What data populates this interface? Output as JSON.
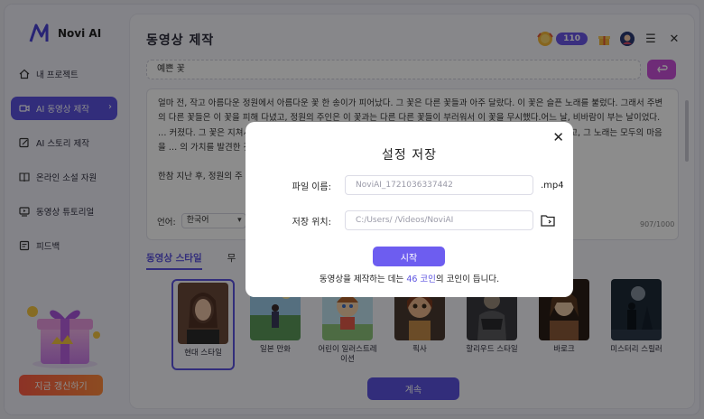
{
  "app": {
    "name": "Novi AI"
  },
  "sidebar": {
    "items": [
      {
        "label": "내 프로젝트",
        "icon": "home-icon"
      },
      {
        "label": "AI 동영상 제작",
        "icon": "video-icon",
        "active": true
      },
      {
        "label": "AI 스토리 제작",
        "icon": "edit-icon"
      },
      {
        "label": "온라인 소설 자원",
        "icon": "book-icon"
      },
      {
        "label": "동영상 튜토리얼",
        "icon": "tutorial-icon"
      },
      {
        "label": "피드백",
        "icon": "feedback-icon"
      }
    ],
    "upgrade_label": "지금 갱신하기"
  },
  "header": {
    "title": "동영상 제작",
    "coins": "110"
  },
  "topic": {
    "value": "예쁜 꽃"
  },
  "story": {
    "text": "얼마 전, 작고 아름다운 정원에서 아름다운 꽃 한 송이가 피어났다. 그 꽃은 다른 꽃들과 아주 달랐다. 이 꽃은 슬픈 노래를 불렀다. 그래서 주변의 다른 꽃들은 이 꽃을 피해 다녔고, 정원의 주인은 이 꽃과는 다른 다른 꽃들이 부러워서 이 꽃을 무시했다.어느 날, 비바람이 부는 날이었다. … 커졌다. 그 꽃은 지쳐서 눈을 감았고, 꽃은 더 … 부르지 않았다. 오히려 새로운 노래를 불렀고, … 꽃과 다르지 않고, 그 노래는 모두의 마음을 … 의 가치를 발견한 것이다.",
    "text2": "한참 지난 후, 정원의 주 … 심을 쏟아주었다. 이 꽃",
    "language_label": "언어:",
    "language_value": "한국어",
    "counter": "907/1000"
  },
  "tabs": [
    {
      "label": "동영상 스타일",
      "active": true
    },
    {
      "label": "무"
    }
  ],
  "styles": [
    {
      "label": "현대 스타일",
      "selected": true
    },
    {
      "label": "일본 만화"
    },
    {
      "label": "어린이 일러스트레이션"
    },
    {
      "label": "픽사"
    },
    {
      "label": "할리우드 스타일"
    },
    {
      "label": "바로크"
    },
    {
      "label": "미스터리 스릴러"
    }
  ],
  "continue_label": "계속",
  "modal": {
    "title": "설정 저장",
    "filename_label": "파일 이름:",
    "filename_value": "NoviAI_1721036337442",
    "extension": ".mp4",
    "location_label": "저장 위치:",
    "location_value": "C:/Users/          /Videos/NoviAI",
    "start_label": "시작",
    "note_prefix": "동영상을 제작하는 데는 ",
    "note_coins": "46 코인",
    "note_suffix": "의 코인이 듭니다."
  }
}
